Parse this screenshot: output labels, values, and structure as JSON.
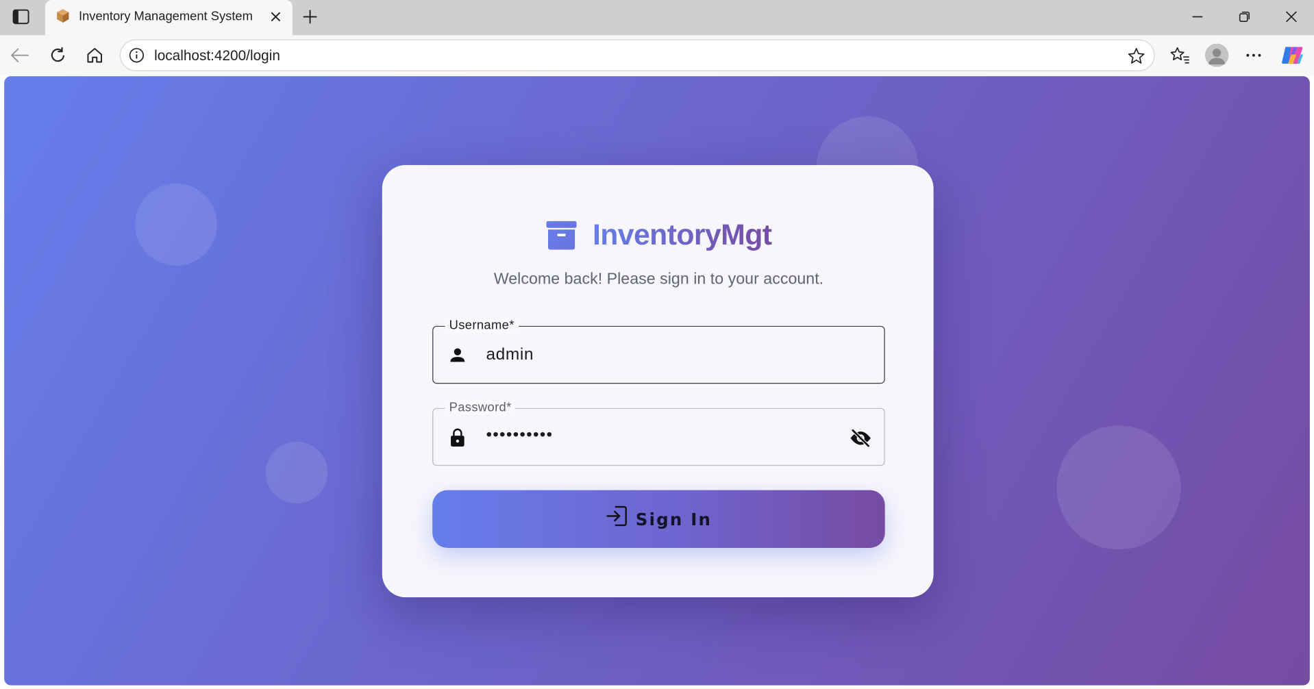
{
  "browser": {
    "tab": {
      "title": "Inventory Management System",
      "favicon": "package-icon"
    },
    "address": {
      "url": "localhost:4200/login"
    },
    "icons": {
      "sidebar_toggle": "sidebar-icon",
      "tab_close": "close-icon",
      "new_tab": "plus-icon",
      "minimize": "minimize-icon",
      "restore": "restore-icon",
      "close_window": "close-icon",
      "back": "back-arrow-icon",
      "reload": "reload-icon",
      "home": "home-icon",
      "site_info": "info-icon",
      "favorite": "star-icon",
      "favorites_list": "favorites-icon",
      "profile": "avatar",
      "more": "more-icon",
      "copilot": "copilot-icon"
    }
  },
  "login": {
    "brand": {
      "name": "InventoryMgt",
      "icon": "archive-icon"
    },
    "subtitle": "Welcome back! Please sign in to your account.",
    "username": {
      "label": "Username*",
      "value": "admin",
      "icon": "person-icon"
    },
    "password": {
      "label": "Password*",
      "value": "••••••••••",
      "icon": "lock-icon",
      "toggle_icon": "visibility-off-icon"
    },
    "submit": {
      "label": "Sign In",
      "icon": "login-icon"
    }
  },
  "colors": {
    "gradient_start": "#667eea",
    "gradient_end": "#764ba2",
    "card_bg": "#faf9fd",
    "subtitle_text": "#5f6473"
  }
}
